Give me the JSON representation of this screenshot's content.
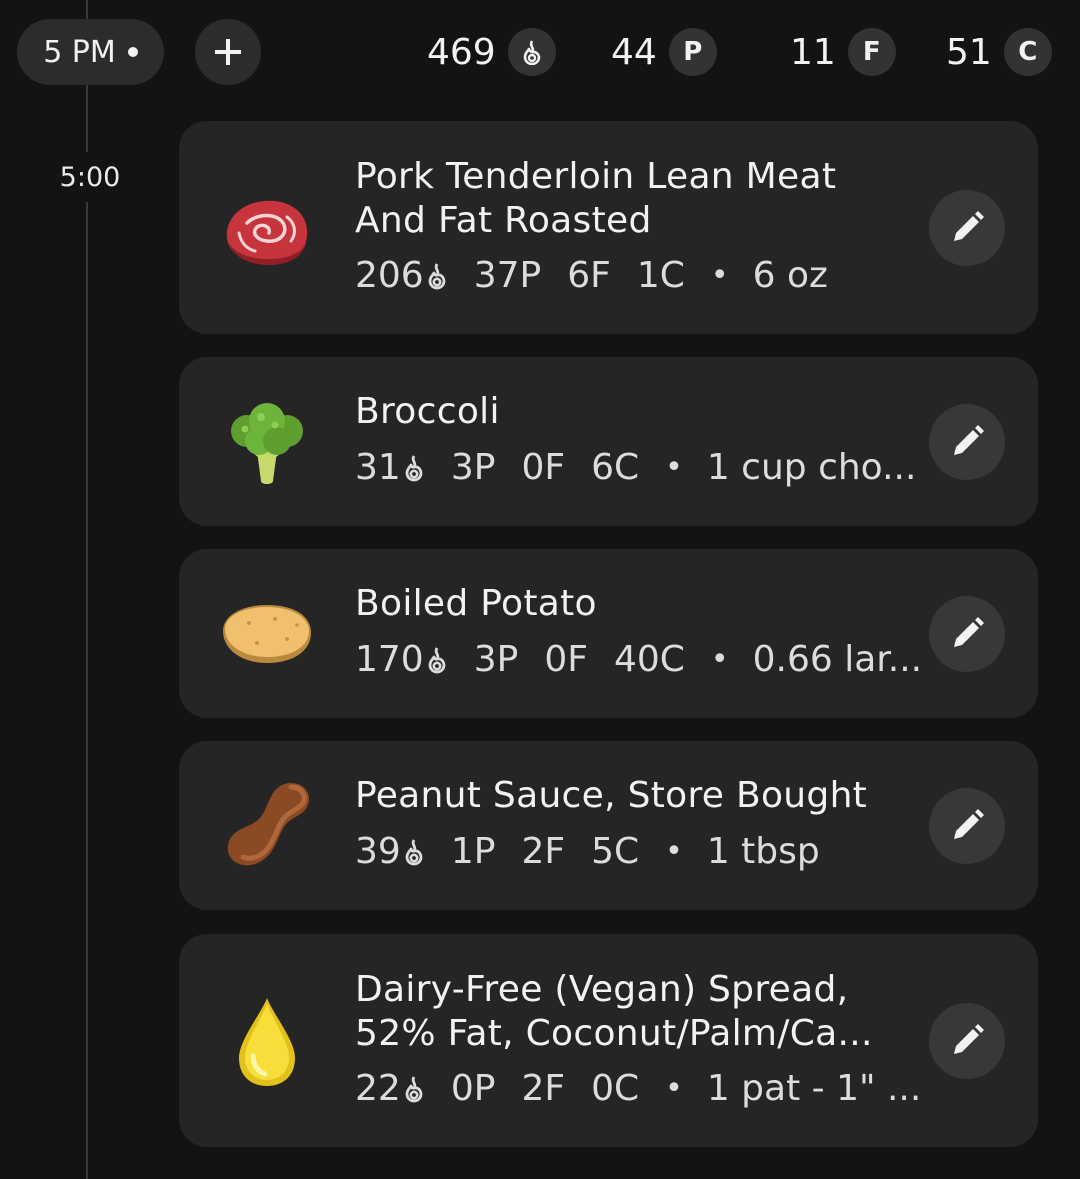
{
  "header": {
    "time_pill": "5 PM",
    "stats": [
      {
        "value": "469",
        "badge": "flame-icon"
      },
      {
        "value": "44",
        "badge": "P"
      },
      {
        "value": "11",
        "badge": "F"
      },
      {
        "value": "51",
        "badge": "C"
      }
    ]
  },
  "timeline": {
    "time_label": "5:00"
  },
  "entries": [
    {
      "icon": "meat-icon",
      "name": "Pork Tenderloin Lean Meat And Fat Roasted",
      "calories": "206",
      "protein": "37P",
      "fat": "6F",
      "carbs": "1C",
      "separator": "•",
      "serving": "6 oz"
    },
    {
      "icon": "broccoli-icon",
      "name": "Broccoli",
      "calories": "31",
      "protein": "3P",
      "fat": "0F",
      "carbs": "6C",
      "separator": "•",
      "serving": "1 cup cho..."
    },
    {
      "icon": "potato-icon",
      "name": "Boiled Potato",
      "calories": "170",
      "protein": "3P",
      "fat": "0F",
      "carbs": "40C",
      "separator": "•",
      "serving": "0.66 lar..."
    },
    {
      "icon": "peanut-icon",
      "name": "Peanut Sauce, Store Bought",
      "calories": "39",
      "protein": "1P",
      "fat": "2F",
      "carbs": "5C",
      "separator": "•",
      "serving": "1 tbsp"
    },
    {
      "icon": "oil-drop-icon",
      "name": "Dairy-Free (Vegan) Spread, 52% Fat, Coconut/Palm/Ca...",
      "calories": "22",
      "protein": "0P",
      "fat": "2F",
      "carbs": "0C",
      "separator": "•",
      "serving": "1 pat - 1\" ..."
    }
  ],
  "colors": {
    "background": "#131313",
    "card": "#252525",
    "pill": "#2c2c2c",
    "edit_button": "#383838",
    "text": "#f2f2f2"
  }
}
